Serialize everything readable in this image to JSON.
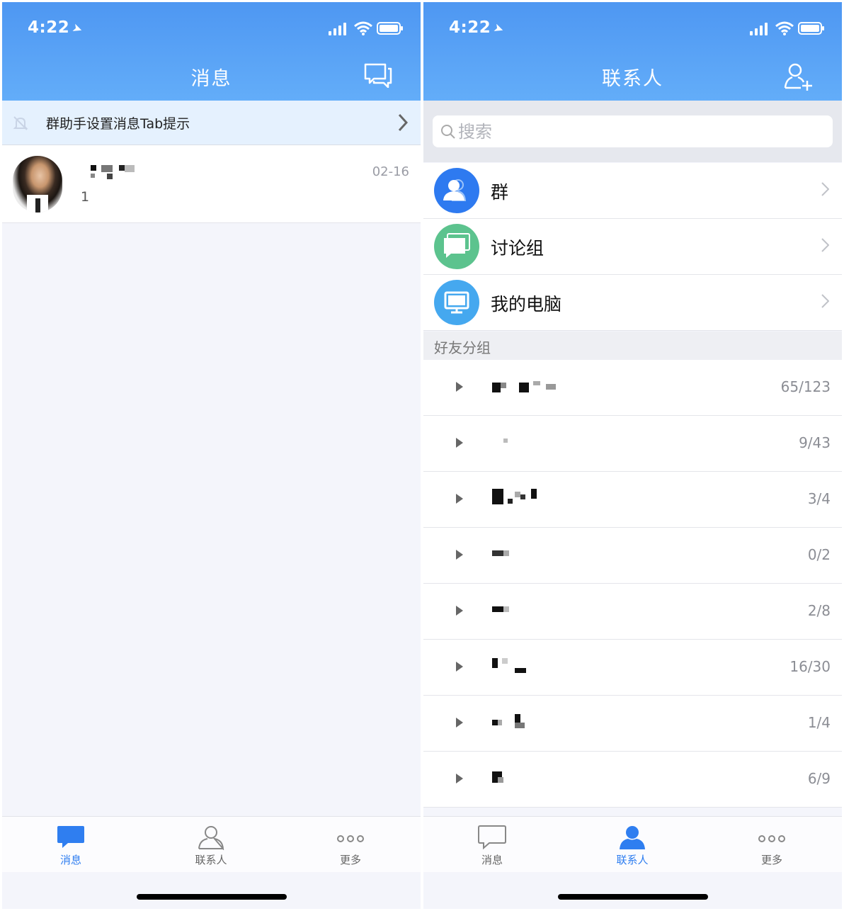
{
  "left": {
    "status": {
      "time": "4:22"
    },
    "nav": {
      "title": "消息"
    },
    "notice": {
      "text": "群助手设置消息Tab提示"
    },
    "message": {
      "time": "02-16",
      "preview": "1"
    },
    "tabbar": {
      "tabs": [
        {
          "label": "消息",
          "icon": "chat-bubble-filled-icon",
          "active": true
        },
        {
          "label": "联系人",
          "icon": "person-outline-icon",
          "active": false
        },
        {
          "label": "更多",
          "icon": "more-dots-icon",
          "active": false
        }
      ]
    }
  },
  "right": {
    "status": {
      "time": "4:22"
    },
    "nav": {
      "title": "联系人"
    },
    "search": {
      "placeholder": "搜索"
    },
    "entries": [
      {
        "label": "群",
        "icon": "group-icon",
        "color": "#2e7af0"
      },
      {
        "label": "讨论组",
        "icon": "discussion-icon",
        "color": "#5cc38e"
      },
      {
        "label": "我的电脑",
        "icon": "computer-icon",
        "color": "#45a8ef"
      }
    ],
    "section": {
      "title": "好友分组"
    },
    "groups": [
      {
        "count": "65/123"
      },
      {
        "count": "9/43"
      },
      {
        "count": "3/4"
      },
      {
        "count": "0/2"
      },
      {
        "count": "2/8"
      },
      {
        "count": "16/30"
      },
      {
        "count": "1/4"
      },
      {
        "count": "6/9"
      }
    ],
    "tabbar": {
      "tabs": [
        {
          "label": "消息",
          "icon": "chat-bubble-outline-icon",
          "active": false
        },
        {
          "label": "联系人",
          "icon": "person-filled-icon",
          "active": true
        },
        {
          "label": "更多",
          "icon": "more-dots-icon",
          "active": false
        }
      ]
    }
  },
  "colors": {
    "accent": "#2f7ef0",
    "header_top": "#4e97f2",
    "header_bottom": "#63adf9"
  }
}
